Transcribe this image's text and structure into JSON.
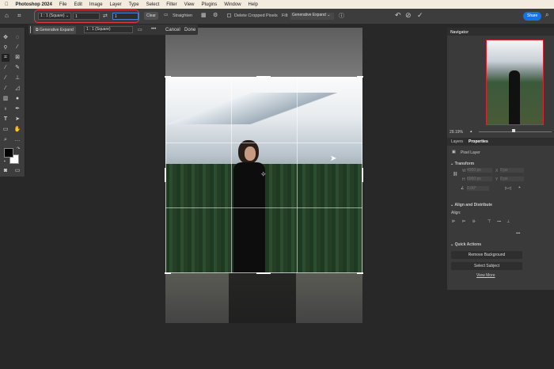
{
  "menubar": {
    "app": "Photoshop 2024",
    "items": [
      "File",
      "Edit",
      "Image",
      "Layer",
      "Type",
      "Select",
      "Filter",
      "View",
      "Plugins",
      "Window",
      "Help"
    ]
  },
  "options": {
    "ratio": "1 : 1 (Square)",
    "width": "1",
    "height": "1",
    "clear": "Clear",
    "straighten": "Straighten",
    "delete_cropped": "Delete Cropped Pixels",
    "fill_label": "Fill:",
    "fill_value": "Generative Expand",
    "share": "Share",
    "highlight_color": "#e0393e"
  },
  "context": {
    "gen_expand": "Generative Expand",
    "ratio": "1 : 1 (Square)",
    "more": "•••",
    "cancel": "Cancel",
    "done": "Done"
  },
  "navigator": {
    "title": "Navigator",
    "zoom": "29.19%"
  },
  "properties": {
    "tabs": [
      "Layers",
      "Properties"
    ],
    "layer_type": "Pixel Layer",
    "transform": "Transform",
    "w_label": "W",
    "w": "4000 px",
    "h_label": "H",
    "h": "6000 px",
    "x_label": "X",
    "x": "0 px",
    "y_label": "Y",
    "y": "0 px",
    "angle": "0.00°",
    "align_distribute": "Align and Distribute",
    "align": "Align:",
    "more": "•••",
    "quick_actions": "Quick Actions",
    "remove_bg": "Remove Background",
    "select_subject": "Select Subject",
    "view_more": "View More"
  },
  "colors": {
    "accent": "#1473e6"
  }
}
